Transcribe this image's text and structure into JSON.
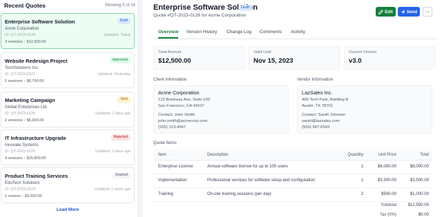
{
  "sidebar": {
    "title": "Recent Quotes",
    "count": "Showing 5 of 24",
    "load_more": "Load More",
    "items": [
      {
        "title": "Enterprise Software Solution",
        "client": "Acme Corporation",
        "id": "ID: QT-2023-0128",
        "updated": "Updated: Today",
        "versions": "3 versions",
        "amount": "$12,500.00",
        "status": "Draft"
      },
      {
        "title": "Website Redesign Project",
        "client": "TechSolutions Inc.",
        "id": "ID: QT-2023-0127",
        "updated": "Updated: Yesterday",
        "versions": "5 versions",
        "amount": "$8,750.00",
        "status": "Approved"
      },
      {
        "title": "Marketing Campaign",
        "client": "Global Enterprises Ltd.",
        "id": "ID: QT-2023-0126",
        "updated": "Updated: 2 days ago",
        "versions": "2 versions",
        "amount": "$5,200.00",
        "status": "Sent"
      },
      {
        "title": "IT Infrastructure Upgrade",
        "client": "Innovate Systems",
        "id": "ID: QT-2023-0125",
        "updated": "Updated: 3 days ago",
        "versions": "4 versions",
        "amount": "$15,800.00",
        "status": "Rejected"
      },
      {
        "title": "Product Training Services",
        "client": "EduTech Solutions",
        "id": "ID: QT-2023-0124",
        "updated": "Updated: 1 week ago",
        "versions": "1 version",
        "amount": "$3,200.00",
        "status": "Expired"
      }
    ]
  },
  "header": {
    "title": "Enterprise Software Solution",
    "status": "Draft",
    "subtitle": "Quote #QT-2023-0128 for Acme Corporation",
    "edit_label": "Edit",
    "send_label": "Send",
    "more_label": "···"
  },
  "tabs": [
    "Overview",
    "Version History",
    "Change Log",
    "Comments",
    "Activity"
  ],
  "stats": {
    "total_label": "Total Amount",
    "total_value": "$12,500.00",
    "valid_label": "Valid Until",
    "valid_value": "Nov 15, 2023",
    "version_label": "Current Version",
    "version_value": "v3.0"
  },
  "client_info": {
    "label": "Client Information",
    "name": "Acme Corporation",
    "address1": "123 Business Ave, Suite 100",
    "address2": "San Francisco, CA 94107",
    "contact": "Contact: John Smith",
    "email": "john.smith@acmecorp.com",
    "phone": "(555) 123-4567"
  },
  "vendor_info": {
    "label": "Vendor Information",
    "name": "LazSales Inc.",
    "address1": "456 Tech Park, Building B",
    "address2": "Austin, TX 78701",
    "contact": "Contact: Sarah Johnson",
    "email": "sarah@lazsales.com",
    "phone": "(555) 987-6543"
  },
  "quote_items": {
    "label": "Quote Items",
    "headers": {
      "item": "Item",
      "description": "Description",
      "quantity": "Quantity",
      "unit_price": "Unit Price",
      "total": "Total"
    },
    "rows": [
      {
        "item": "Enterprise License",
        "description": "Annual software license for up to 100 users",
        "quantity": "1",
        "unit_price": "$8,000.00",
        "total": "$8,000.00"
      },
      {
        "item": "Implementation",
        "description": "Professional services for software setup and configuration",
        "quantity": "1",
        "unit_price": "$3,500.00",
        "total": "$3,500.00"
      },
      {
        "item": "Training",
        "description": "On-site training sessions (per day)",
        "quantity": "2",
        "unit_price": "$500.00",
        "total": "$1,000.00"
      }
    ],
    "subtotal_label": "Subtotal",
    "subtotal_value": "$12,500.00",
    "tax_label": "Tax (0%)",
    "tax_value": "$0.00"
  },
  "colors": {
    "accent_green": "#15803d",
    "accent_blue": "#2563eb",
    "active_card_bg": "#ecfdf3"
  }
}
